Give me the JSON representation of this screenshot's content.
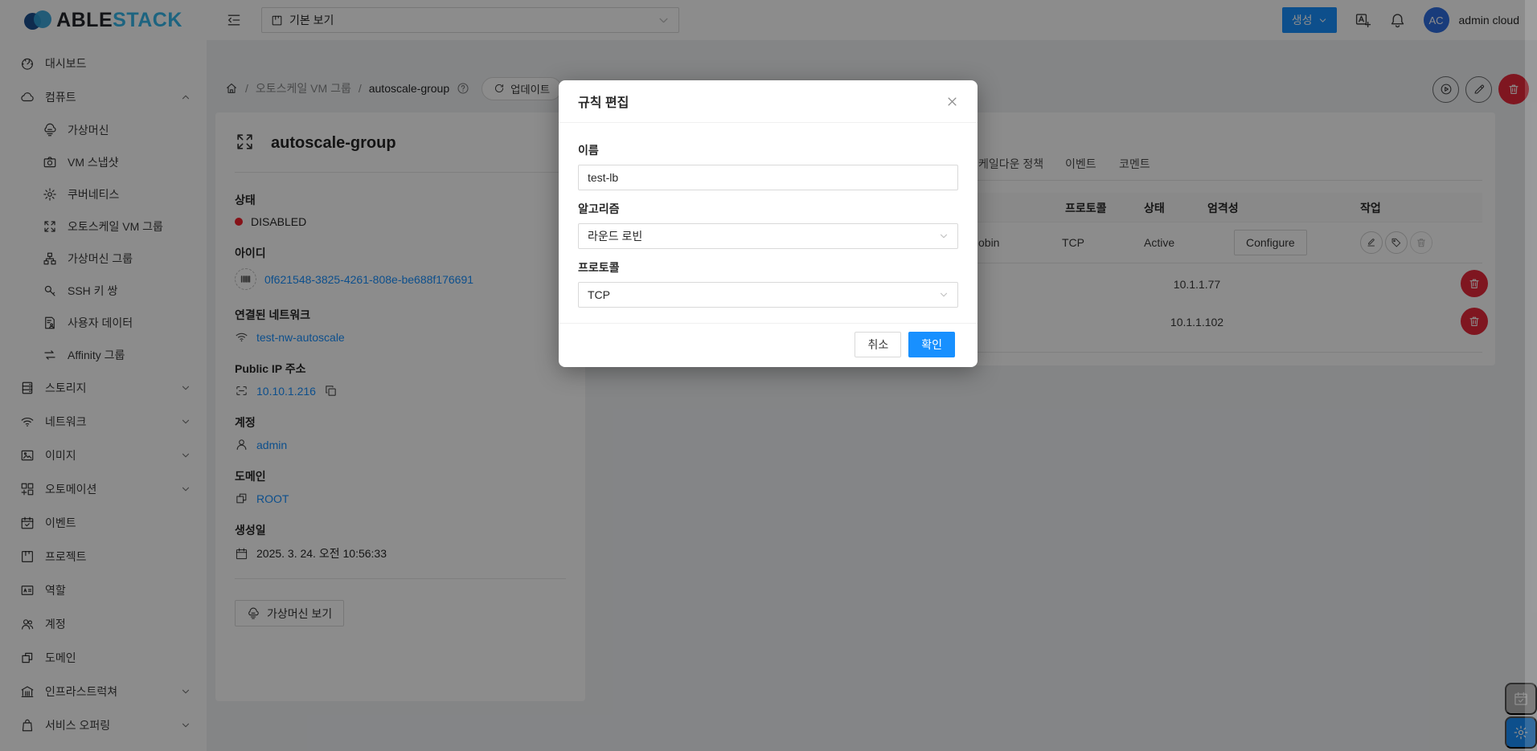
{
  "theme": {
    "primary": "#1890ff",
    "danger": "#e8293b",
    "link": "#1890ff"
  },
  "brand": {
    "name_dark": "ABLE",
    "name_blue": "STACK"
  },
  "topbar": {
    "view_select": {
      "value": "기본 보기",
      "icon": "project-icon"
    },
    "create_button": {
      "label": "생성"
    },
    "user": {
      "initials": "AC",
      "name": "admin cloud"
    }
  },
  "breadcrumb": {
    "section": "오토스케일 VM 그룹",
    "current": "autoscale-group",
    "update_button": "업데이트"
  },
  "sidebar": {
    "items": [
      {
        "label": "대시보드",
        "icon": "dashboard-icon"
      },
      {
        "label": "컴퓨트",
        "icon": "cloud-icon",
        "chevron": "up"
      },
      {
        "label": "가상머신",
        "icon": "cloud-server-icon",
        "sub": true
      },
      {
        "label": "VM 스냅샷",
        "icon": "camera-icon",
        "sub": true
      },
      {
        "label": "쿠버네티스",
        "icon": "kubernetes-icon",
        "sub": true
      },
      {
        "label": "오토스케일 VM 그룹",
        "icon": "autoscale-icon",
        "sub": true
      },
      {
        "label": "가상머신 그룹",
        "icon": "cluster-icon",
        "sub": true
      },
      {
        "label": "SSH 키 쌍",
        "icon": "key-icon",
        "sub": true
      },
      {
        "label": "사용자 데이터",
        "icon": "user-data-icon",
        "sub": true
      },
      {
        "label": "Affinity 그룹",
        "icon": "swap-icon",
        "sub": true
      },
      {
        "label": "스토리지",
        "icon": "storage-icon",
        "chevron": "down"
      },
      {
        "label": "네트워크",
        "icon": "network-icon",
        "chevron": "down"
      },
      {
        "label": "이미지",
        "icon": "image-icon",
        "chevron": "down"
      },
      {
        "label": "오토메이션",
        "icon": "automation-icon",
        "chevron": "down"
      },
      {
        "label": "이벤트",
        "icon": "event-icon"
      },
      {
        "label": "프로젝트",
        "icon": "project-icon"
      },
      {
        "label": "역할",
        "icon": "role-icon"
      },
      {
        "label": "계정",
        "icon": "account-icon"
      },
      {
        "label": "도메인",
        "icon": "domain-icon"
      },
      {
        "label": "인프라스트럭쳐",
        "icon": "infrastructure-icon",
        "chevron": "down"
      },
      {
        "label": "서비스 오퍼링",
        "icon": "offering-icon",
        "chevron": "down"
      }
    ]
  },
  "detail_card": {
    "title": "autoscale-group",
    "fields": [
      {
        "label": "상태",
        "type": "status",
        "value": "DISABLED"
      },
      {
        "label": "아이디",
        "type": "link",
        "icon": "barcode-icon",
        "dashed": true,
        "value": "0f621548-3825-4261-808e-be688f176691"
      },
      {
        "label": "연결된 네트워크",
        "type": "link",
        "icon": "network-icon",
        "value": "test-nw-autoscale"
      },
      {
        "label": "Public IP 주소",
        "type": "link",
        "icon": "ip-frame-icon",
        "value": "10.10.1.216",
        "copy": true
      },
      {
        "label": "계정",
        "type": "link",
        "icon": "user-icon",
        "value": "admin"
      },
      {
        "label": "도메인",
        "type": "link",
        "icon": "domain-icon",
        "value": "ROOT"
      },
      {
        "label": "생성일",
        "type": "text",
        "icon": "calendar-icon",
        "value": "2025. 3. 24. 오전 10:56:33"
      }
    ],
    "footer_button": {
      "label": "가상머신 보기",
      "icon": "cloud-server-icon"
    }
  },
  "content_tabs": [
    {
      "label": "케일다운 정책"
    },
    {
      "label": "이벤트"
    },
    {
      "label": "코멘트"
    }
  ],
  "rules_table": {
    "columns": [
      "프로토콜",
      "상태",
      "엄격성",
      "작업"
    ],
    "rule_row": {
      "algorithm_visible": "obin",
      "protocol": "TCP",
      "state": "Active",
      "configure_label": "Configure"
    },
    "member_rows": [
      {
        "ip": "10.1.1.77"
      },
      {
        "ip": "10.1.1.102"
      }
    ]
  },
  "modal": {
    "title": "규칙 편집",
    "fields": [
      {
        "name": "name",
        "label": "이름",
        "type": "input",
        "value": "test-lb"
      },
      {
        "name": "algorithm",
        "label": "알고리즘",
        "type": "select",
        "value": "라운드 로빈"
      },
      {
        "name": "protocol",
        "label": "프로토콜",
        "type": "select",
        "value": "TCP"
      }
    ],
    "cancel_label": "취소",
    "ok_label": "확인"
  }
}
